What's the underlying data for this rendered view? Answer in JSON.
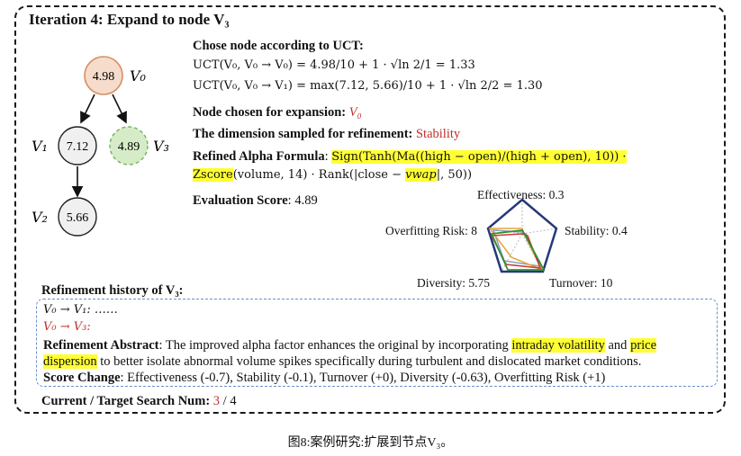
{
  "header": {
    "title": "Iteration 4: Expand to node V₃"
  },
  "tree": {
    "nodes": [
      {
        "id": "V0",
        "value": "4.98",
        "label": "V₀",
        "fill": "#f5dccb",
        "stroke": "#d98c5f",
        "dashed": false
      },
      {
        "id": "V1",
        "value": "7.12",
        "label": "V₁",
        "fill": "#f0f0f0",
        "stroke": "#222222",
        "dashed": false
      },
      {
        "id": "V3",
        "value": "4.89",
        "label": "V₃",
        "fill": "#d6ecc8",
        "stroke": "#72b35a",
        "dashed": true
      },
      {
        "id": "V2",
        "value": "5.66",
        "label": "V₂",
        "fill": "#f0f0f0",
        "stroke": "#222222",
        "dashed": false
      }
    ]
  },
  "uct": {
    "heading": "Chose node according to UCT:",
    "line1": "UCT(V₀, V₀ → V₀) = 4.98/10 + 1 · √ln 2/1 = 1.33",
    "line2": "UCT(V₀, V₀ → V₁) = max(7.12, 5.66)/10 + 1 · √ln 2/2 = 1.30"
  },
  "expansion": {
    "label": "Node chosen for expansion: ",
    "value": "V₀"
  },
  "dimension": {
    "label": "The dimension sampled for refinement: ",
    "value": "Stability"
  },
  "formula": {
    "label": "Refined Alpha Formula",
    "line1": "Sign(Tanh(Ma((high − open)/(high + open), 10)) ·",
    "line2_hl": "Zscore",
    "line2_rest": "(volume, 14) · Rank(|close − ",
    "line2_hl2": "vwap",
    "line2_end": "|, 50))"
  },
  "evaluation": {
    "label": "Evaluation Score",
    "value": ": 4.89"
  },
  "radar": {
    "labels": {
      "effectiveness": "Effectiveness: 0.3",
      "stability": "Stability: 0.4",
      "turnover": "Turnover: 10",
      "diversity": "Diversity: 5.75",
      "overfitting": "Overfitting Risk: 8"
    },
    "colors": {
      "outline": "#23397a",
      "series": [
        "#e8a33c",
        "#c83a2e",
        "#2f8f3a",
        "#8aa0b8"
      ]
    }
  },
  "history": {
    "heading": "Refinement history of V₃:",
    "step1": "V₀ → V₁:  ……",
    "step2": "V₀ → V₃:",
    "abstract_label": "Refinement Abstract",
    "abstract_1": ": The improved alpha factor enhances the original by incorporating ",
    "abstract_hl1": "intraday volatility",
    "abstract_2": " and ",
    "abstract_hl2a": "price",
    "abstract_hl2b": "dispersion",
    "abstract_3": " to better isolate abnormal volume spikes specifically during turbulent and dislocated market conditions.",
    "score_label": "Score Change",
    "score_text": ": Effectiveness (-0.7), Stability (-0.1), Turnover (+0), Diversity (-0.63), Overfitting Risk (+1)"
  },
  "search": {
    "label": "Current / Target Search Num: ",
    "current": "3",
    "sep": " / ",
    "target": "4"
  },
  "caption": "图8:案例研究:扩展到节点V₃。"
}
